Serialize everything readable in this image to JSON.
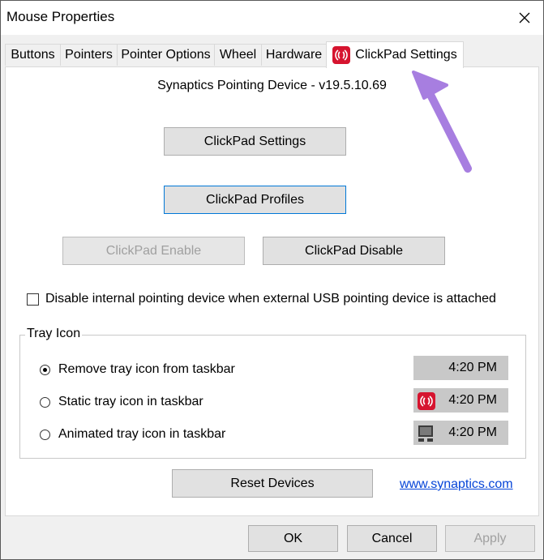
{
  "window": {
    "title": "Mouse Properties"
  },
  "tabs": [
    {
      "label": "Buttons"
    },
    {
      "label": "Pointers"
    },
    {
      "label": "Pointer Options"
    },
    {
      "label": "Wheel"
    },
    {
      "label": "Hardware"
    },
    {
      "label": "ClickPad Settings",
      "active": true,
      "icon": "synaptics-icon"
    }
  ],
  "panel": {
    "device_label": "Synaptics Pointing Device - v19.5.10.69",
    "buttons": {
      "clickpad_settings": "ClickPad Settings",
      "clickpad_profiles": "ClickPad Profiles",
      "clickpad_enable": "ClickPad Enable",
      "clickpad_disable": "ClickPad Disable"
    },
    "disable_internal_label": "Disable internal pointing device when external USB pointing device is attached",
    "disable_internal_checked": false,
    "tray": {
      "legend": "Tray Icon",
      "options": [
        {
          "label": "Remove tray icon from taskbar",
          "checked": true,
          "time": "4:20 PM",
          "icon": null
        },
        {
          "label": "Static tray icon in taskbar",
          "checked": false,
          "time": "4:20 PM",
          "icon": "synaptics-icon"
        },
        {
          "label": "Animated tray icon in taskbar",
          "checked": false,
          "time": "4:20 PM",
          "icon": "touchpad-icon"
        }
      ]
    },
    "reset_label": "Reset Devices",
    "link": "www.synaptics.com"
  },
  "footer": {
    "ok": "OK",
    "cancel": "Cancel",
    "apply": "Apply"
  },
  "colors": {
    "accent_arrow": "#a77ee0",
    "synaptics_red": "#d6142f",
    "link": "#0645d8"
  }
}
